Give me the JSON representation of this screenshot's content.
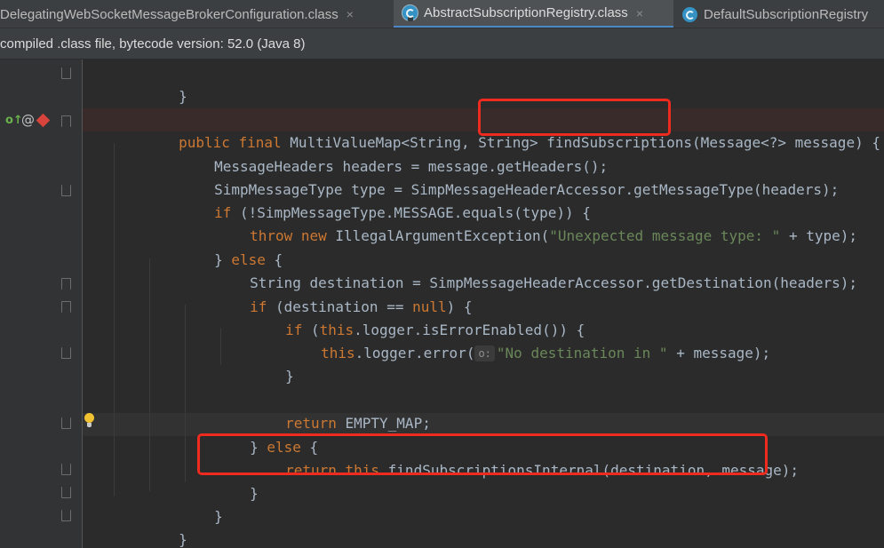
{
  "tabs": [
    {
      "label": "DelegatingWebSocketMessageBrokerConfiguration.class",
      "active": false,
      "icon": "class-icon"
    },
    {
      "label": "AbstractSubscriptionRegistry.class",
      "active": true,
      "icon": "abstract-class-icon"
    },
    {
      "label": "DefaultSubscriptionRegistry",
      "active": false,
      "icon": "class-icon"
    }
  ],
  "tab_close_glyph": "×",
  "banner": {
    "text": "compiled .class file, bytecode version: 52.0 (Java 8)"
  },
  "gutter_icons": [
    "override-marker-icon",
    "annotation-icon",
    "breakpoint-diamond-icon",
    "fold-icon",
    "lightbulb-intention-icon"
  ],
  "colors": {
    "keyword": "#cc7832",
    "string": "#6a8759",
    "identifier": "#a9b7c6",
    "field": "#9876aa",
    "background": "#2b2b2b",
    "highlight_box": "#ef2a1f"
  },
  "code": {
    "l0": [
      "}"
    ],
    "l2": [
      "public final ",
      "MultiValueMap<String, String> ",
      "findSubscriptions",
      "(Message<?> message) {"
    ],
    "l3": [
      "MessageHeaders headers = message.getHeaders();"
    ],
    "l4": [
      "SimpMessageType type = SimpMessageHeaderAccessor.getMessageType(headers);"
    ],
    "l5": [
      "if ",
      "(!SimpMessageType.MESSAGE.equals(type)) {"
    ],
    "l6": [
      "throw new ",
      "IllegalArgumentException(",
      "\"Unexpected message type: \"",
      " + type);"
    ],
    "l7": [
      "} ",
      "else ",
      "{"
    ],
    "l8": [
      "String destination = SimpMessageHeaderAccessor.getDestination(headers);"
    ],
    "l9": [
      "if ",
      "(destination == ",
      "null",
      ") {"
    ],
    "l10": [
      "if ",
      "(",
      "this",
      ".logger.isErrorEnabled()) {"
    ],
    "l11": [
      "this",
      ".logger.error(",
      "o:",
      "\"No destination in \"",
      " + message);"
    ],
    "l12": [
      "}"
    ],
    "l14": [
      "return ",
      "EMPTY_MAP;"
    ],
    "l15": [
      "} ",
      "else ",
      "{"
    ],
    "l16": [
      "return ",
      "this",
      ".findSubscriptionsInternal(destination, message);"
    ],
    "l17": [
      "}"
    ],
    "l18": [
      "}"
    ],
    "l19": [
      "}"
    ]
  }
}
